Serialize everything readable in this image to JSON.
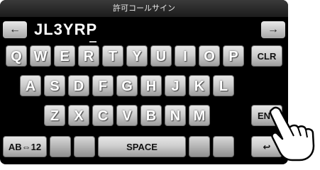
{
  "title": "許可コールサイン",
  "callsign": "JL3YRP",
  "arrows": {
    "left": "←",
    "right": "→"
  },
  "rows": [
    [
      "Q",
      "W",
      "E",
      "R",
      "T",
      "Y",
      "U",
      "I",
      "O",
      "P"
    ],
    [
      "A",
      "S",
      "D",
      "F",
      "G",
      "H",
      "J",
      "K",
      "L"
    ],
    [
      "Z",
      "X",
      "C",
      "V",
      "B",
      "N",
      "M"
    ]
  ],
  "keys": {
    "clr": "CLR",
    "ent": "ENT",
    "mode": "AB⇔12",
    "space": "SPACE",
    "back": "↩"
  },
  "colors": {
    "background": "#000000",
    "key_top": "#e6e6e6",
    "key_bottom": "#9d9d9d"
  }
}
